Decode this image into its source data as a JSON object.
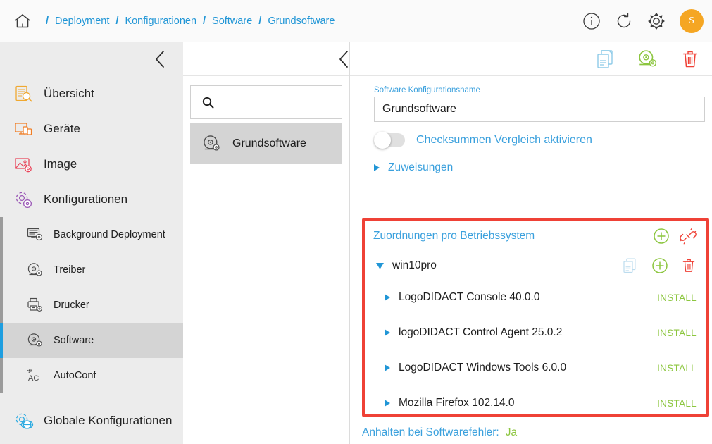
{
  "topbar": {
    "home_icon": "home-icon",
    "breadcrumbs": [
      "Deployment",
      "Konfigurationen",
      "Software",
      "Grundsoftware"
    ],
    "separator": "/",
    "actions": [
      {
        "name": "info-icon",
        "label": "i"
      },
      {
        "name": "refresh-icon",
        "label": ""
      },
      {
        "name": "gear-icon",
        "label": ""
      }
    ],
    "avatar_initial": "S",
    "avatar_color": "#f5a623"
  },
  "sidebar": {
    "collapse_icon": "chevron-left-icon",
    "items": [
      {
        "label": "Übersicht",
        "icon": "overview-icon",
        "color": "#f0a830"
      },
      {
        "label": "Geräte",
        "icon": "devices-icon",
        "color": "#f07e26"
      },
      {
        "label": "Image",
        "icon": "image-icon",
        "color": "#e8455a"
      },
      {
        "label": "Konfigurationen",
        "icon": "config-gear-icon",
        "color": "#9b59b6"
      }
    ],
    "sub_items": [
      {
        "label": "Background Deployment",
        "icon": "background-deployment-icon",
        "selected": false
      },
      {
        "label": "Treiber",
        "icon": "driver-disc-icon",
        "selected": false
      },
      {
        "label": "Drucker",
        "icon": "printer-icon",
        "selected": false
      },
      {
        "label": "Software",
        "icon": "software-disc-icon",
        "selected": true
      },
      {
        "label": "AutoConf",
        "icon": "autoconf-icon",
        "selected": false
      }
    ],
    "global_item": {
      "label": "Globale Konfigurationen",
      "icon": "global-config-icon",
      "color": "#2aaae1"
    },
    "selection_accent": "#1e9ee0"
  },
  "list_panel": {
    "search_placeholder": "",
    "search_value": "",
    "search_icon": "search-icon",
    "items": [
      {
        "label": "Grundsoftware",
        "icon": "software-disc-icon",
        "selected": true
      }
    ]
  },
  "detail": {
    "back_icon": "chevron-left-icon",
    "toolbar": [
      {
        "name": "copy-config-icon",
        "color": "#8ecbe8"
      },
      {
        "name": "software-disc-icon",
        "color": "#8cc63f"
      },
      {
        "name": "delete-icon",
        "color": "#ef4136"
      }
    ],
    "name_field": {
      "label": "Software Konfigurationsname",
      "value": "Grundsoftware"
    },
    "checksum_toggle": {
      "label": "Checksummen Vergleich aktivieren",
      "state": "off"
    },
    "assignments_section": {
      "label": "Zuweisungen",
      "expanded": false
    },
    "os_assignments": {
      "title": "Zuordnungen pro Betriebssystem",
      "highlight_color": "#ef4136",
      "header_tools": [
        {
          "name": "add-os-icon",
          "color": "#8cc63f"
        },
        {
          "name": "unlink-icon",
          "color": "#ef4136"
        }
      ],
      "os_groups": [
        {
          "name": "win10pro",
          "expanded": true,
          "tools": [
            {
              "name": "copy-os-icon",
              "color": "#bcdcee"
            },
            {
              "name": "add-package-icon",
              "color": "#8cc63f"
            },
            {
              "name": "delete-os-icon",
              "color": "#ef4136"
            }
          ],
          "packages": [
            {
              "name": "LogoDIDACT Console 40.0.0",
              "action": "INSTALL"
            },
            {
              "name": "logoDIDACT Control Agent 25.0.2",
              "action": "INSTALL"
            },
            {
              "name": "LogoDIDACT Windows Tools 6.0.0",
              "action": "INSTALL"
            },
            {
              "name": "Mozilla Firefox 102.14.0",
              "action": "INSTALL"
            }
          ]
        }
      ]
    },
    "footer": {
      "label": "Anhalten bei Softwarefehler:",
      "value": "Ja"
    }
  }
}
